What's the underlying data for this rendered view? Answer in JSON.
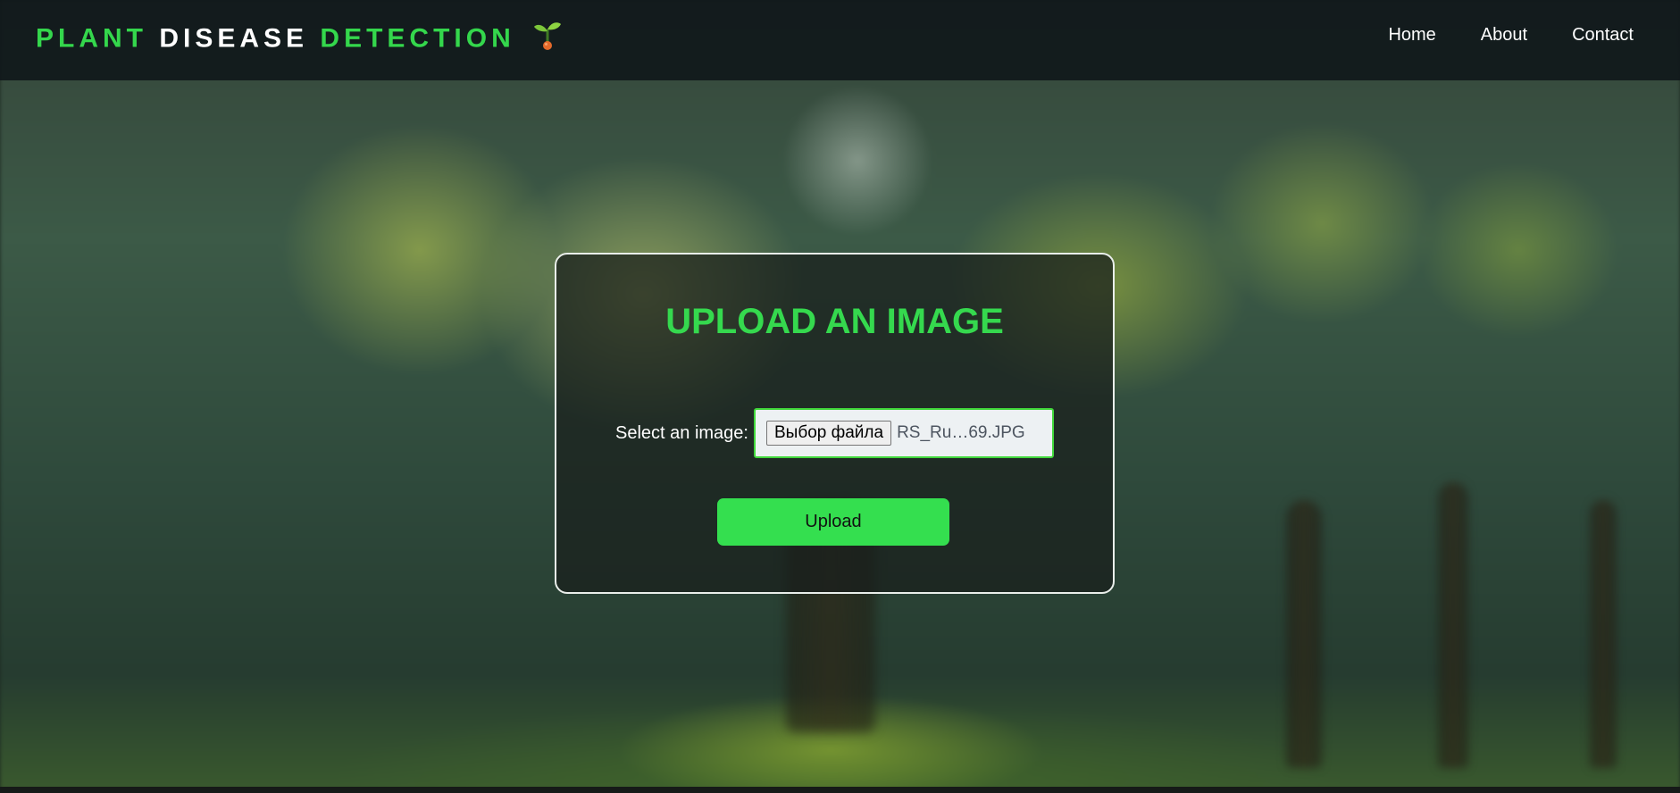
{
  "navbar": {
    "brand": {
      "word1": "PLANT",
      "word2": "DISEASE",
      "word3": "DETECTION",
      "icon": "sprout-icon"
    },
    "links": [
      {
        "label": "Home"
      },
      {
        "label": "About"
      },
      {
        "label": "Contact"
      }
    ]
  },
  "upload_card": {
    "title": "UPLOAD AN IMAGE",
    "field_label": "Select an image:",
    "file_button_label": "Выбор файла",
    "file_name": "RS_Ru…69.JPG",
    "submit_label": "Upload"
  },
  "colors": {
    "accent_green": "#34d74c",
    "button_green": "#34df4f",
    "navbar_bg": "#0f1619"
  }
}
